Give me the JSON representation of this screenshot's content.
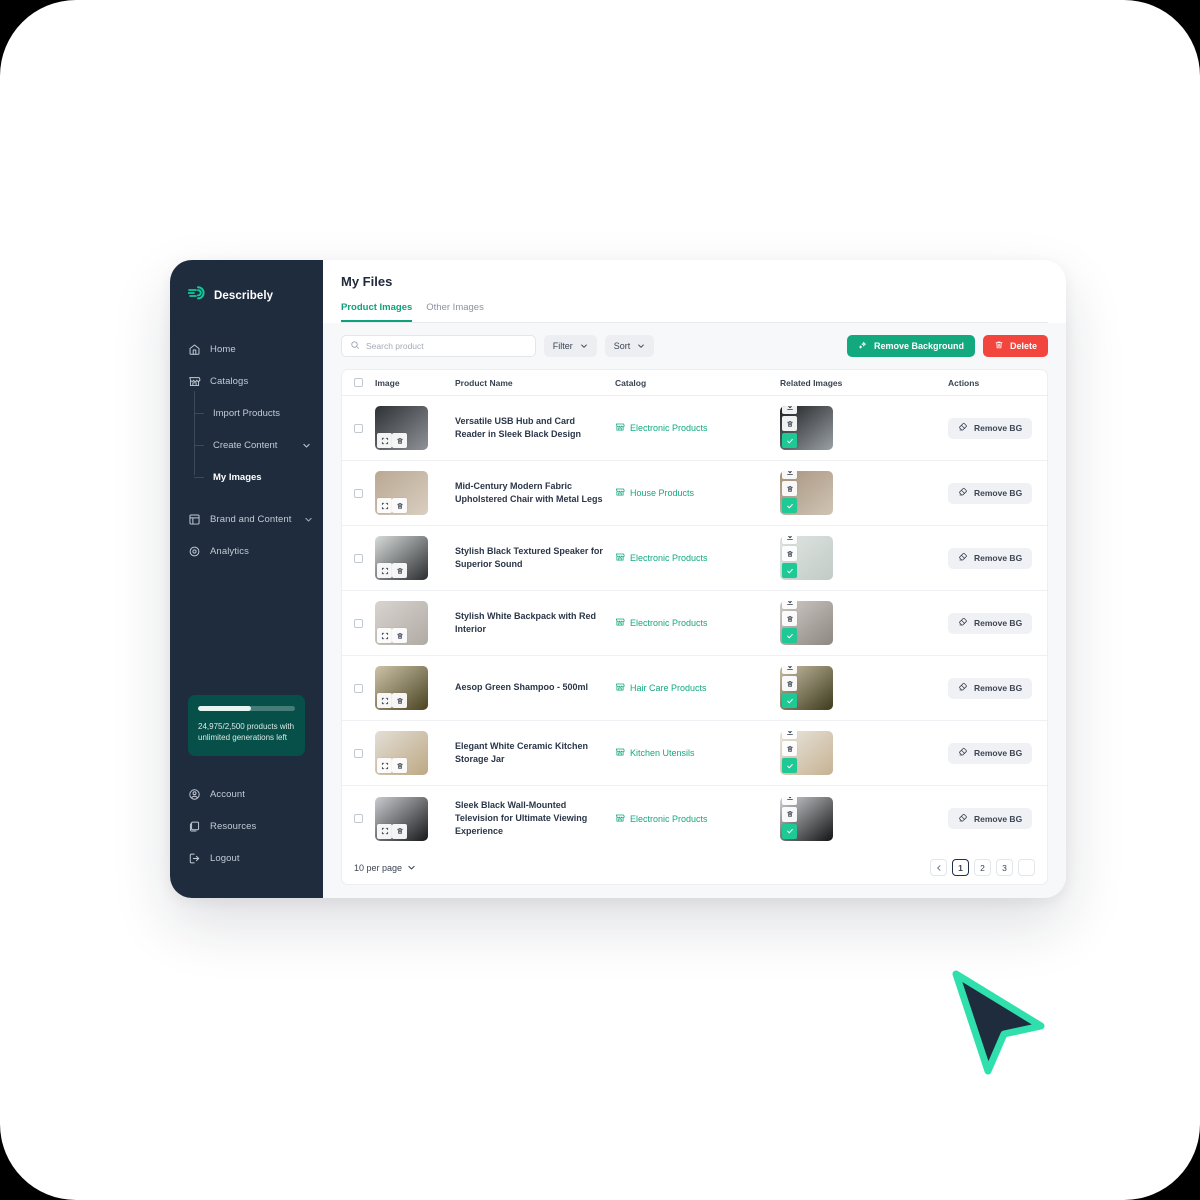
{
  "brand": {
    "name": "Describely",
    "logo_icon": "describely-speed-logo"
  },
  "sidebar": {
    "items": [
      {
        "label": "Home",
        "icon": "home-icon"
      },
      {
        "label": "Catalogs",
        "icon": "store-icon"
      }
    ],
    "sub_items": [
      {
        "label": "Import Products",
        "active": false,
        "has_chevron": false
      },
      {
        "label": "Create Content",
        "active": false,
        "has_chevron": true
      },
      {
        "label": "My Images",
        "active": true,
        "has_chevron": false
      }
    ],
    "items2": [
      {
        "label": "Brand and Content",
        "icon": "brand-icon",
        "has_chevron": true
      },
      {
        "label": "Analytics",
        "icon": "analytics-icon",
        "has_chevron": false
      }
    ],
    "usage": {
      "text": "24,975/2,500 products with unlimited generations left",
      "progress_percent": 55,
      "bg_color": "#065049"
    },
    "bottom_items": [
      {
        "label": "Account",
        "icon": "user-circle-icon"
      },
      {
        "label": "Resources",
        "icon": "folder-icon"
      },
      {
        "label": "Logout",
        "icon": "logout-icon"
      }
    ]
  },
  "header": {
    "title": "My Files",
    "tabs": [
      {
        "label": "Product Images",
        "active": true
      },
      {
        "label": "Other Images",
        "active": false
      }
    ]
  },
  "toolbar": {
    "search": {
      "placeholder": "Search product",
      "value": ""
    },
    "filter_label": "Filter",
    "sort_label": "Sort",
    "remove_background_label": "Remove Background",
    "delete_label": "Delete",
    "green": "#12a97f",
    "red": "#f2453d"
  },
  "table": {
    "columns": [
      "Image",
      "Product Name",
      "Catalog",
      "Related Images",
      "Actions"
    ],
    "action_label": "Remove BG",
    "rows": [
      {
        "name": "Versatile USB Hub and Card Reader in Sleek Black Design",
        "catalog": "Electronic Products",
        "thumb_a": "#2e3134",
        "thumb_b": "#8f9398",
        "rel_a": "#1d1f21",
        "rel_b": "#9aa0a5"
      },
      {
        "name": "Mid-Century Modern Fabric Upholstered Chair with Metal Legs",
        "catalog": "House Products",
        "thumb_a": "#b9a893",
        "thumb_b": "#d9cec0",
        "rel_a": "#a8947e",
        "rel_b": "#cfc4b5"
      },
      {
        "name": "Stylish Black Textured Speaker for Superior Sound",
        "catalog": "Electronic Products",
        "thumb_a": "#d7dbd9",
        "thumb_b": "#2b2d30",
        "rel_a": "#dfe5e2",
        "rel_b": "#c2cbc7"
      },
      {
        "name": "Stylish White Backpack with Red Interior",
        "catalog": "Electronic Products",
        "thumb_a": "#d8d4cf",
        "thumb_b": "#b0aaa4",
        "rel_a": "#cfcbc6",
        "rel_b": "#8e8782"
      },
      {
        "name": "Aesop Green Shampoo - 500ml",
        "catalog": "Hair Care Products",
        "thumb_a": "#cdc3a9",
        "thumb_b": "#4a4422",
        "rel_a": "#c9bfa6",
        "rel_b": "#3d3a1d"
      },
      {
        "name": "Elegant White Ceramic Kitchen Storage Jar",
        "catalog": "Kitchen Utensils",
        "thumb_a": "#e3ded6",
        "thumb_b": "#bda883",
        "rel_a": "#eae6df",
        "rel_b": "#c6b292"
      },
      {
        "name": "Sleek Black Wall-Mounted Television for Ultimate Viewing Experience",
        "catalog": "Electronic Products",
        "thumb_a": "#c9ccd0",
        "thumb_b": "#17181a",
        "rel_a": "#d2d5d8",
        "rel_b": "#121315"
      }
    ]
  },
  "footer": {
    "per_page_label": "10 per page",
    "pages": [
      "1",
      "2",
      "3"
    ],
    "active_page": "1"
  }
}
